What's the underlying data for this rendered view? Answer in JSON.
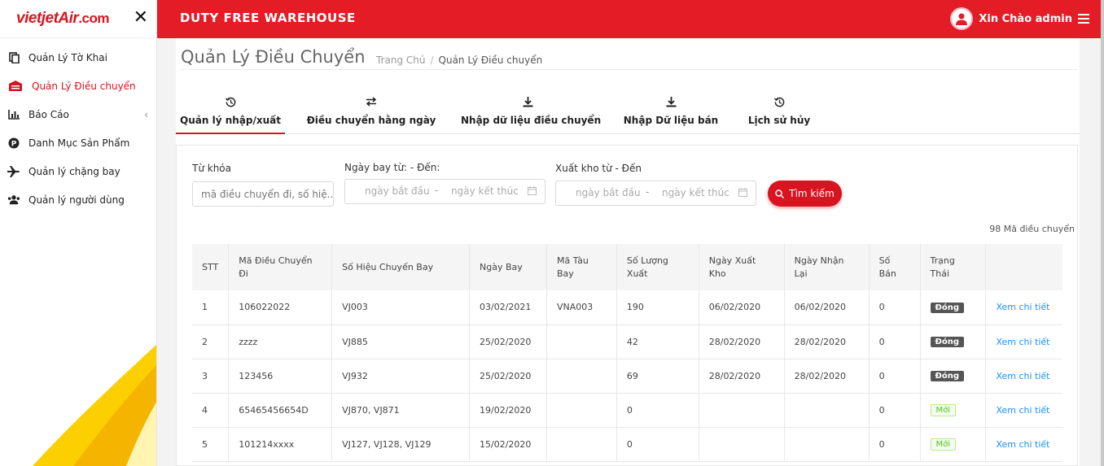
{
  "brand": {
    "logo_main": "vietjet",
    "logo_air": "Air",
    "logo_domain": ".com"
  },
  "sidebar": {
    "items": [
      {
        "label": "Quản Lý Tờ Khai",
        "icon": "copy-icon",
        "active": false
      },
      {
        "label": "Quản Lý Điều chuyển",
        "icon": "warehouse-icon",
        "active": true
      },
      {
        "label": "Báo Cáo",
        "icon": "bar-chart-icon",
        "active": false,
        "chevron": "‹"
      },
      {
        "label": "Danh Mục Sản Phẩm",
        "icon": "product-circle-icon",
        "active": false
      },
      {
        "label": "Quản lý chặng bay",
        "icon": "plane-icon",
        "active": false
      },
      {
        "label": "Quản lý người dùng",
        "icon": "users-icon",
        "active": false
      }
    ]
  },
  "header": {
    "title": "DUTY FREE WAREHOUSE",
    "greeting": "Xin Chào admin"
  },
  "page": {
    "title": "Quản Lý Điều Chuyển",
    "breadcrumb_home": "Trang Chủ",
    "breadcrumb_sep": "/",
    "breadcrumb_current": "Quản Lý Điều chuyển"
  },
  "tabs": [
    {
      "label": "Quản lý nhập/xuất",
      "icon": "history-icon"
    },
    {
      "label": "Điều chuyển hằng ngày",
      "icon": "swap-icon"
    },
    {
      "label": "Nhập dữ liệu điều chuyển",
      "icon": "download-icon"
    },
    {
      "label": "Nhập Dữ liệu bán",
      "icon": "download-icon"
    },
    {
      "label": "Lịch sử hủy",
      "icon": "history-icon"
    }
  ],
  "filters": {
    "keyword_label": "Từ khóa",
    "keyword_placeholder": "mã điều chuyển đi, số hiệ...",
    "flight_date_label": "Ngày bay từ: - Đến:",
    "export_date_label": "Xuất kho từ - Đến",
    "start_placeholder": "ngày bắt đầu",
    "end_placeholder": "ngày kết thúc",
    "range_dash": "-",
    "search_button": "Tìm kiếm"
  },
  "count_text": "98 Mã điều chuyển",
  "table": {
    "headers": [
      "STT",
      "Mã Điều Chuyển Đi",
      "Số Hiệu Chuyến Bay",
      "Ngày Bay",
      "Mã Tàu Bay",
      "Số Lượng Xuất",
      "Ngày Xuất Kho",
      "Ngày Nhận Lại",
      "Số Bán",
      "Trạng Thái",
      ""
    ],
    "rows": [
      {
        "stt": "1",
        "code": "106022022",
        "flight": "VJ003",
        "date": "03/02/2021",
        "aircraft": "VNA003",
        "qty": "190",
        "export": "06/02/2020",
        "received": "06/02/2020",
        "sold": "0",
        "status": "Đóng",
        "action": "Xem chi tiết"
      },
      {
        "stt": "2",
        "code": "zzzz",
        "flight": "VJ885",
        "date": "25/02/2020",
        "aircraft": "",
        "qty": "42",
        "export": "28/02/2020",
        "received": "28/02/2020",
        "sold": "0",
        "status": "Đóng",
        "action": "Xem chi tiết"
      },
      {
        "stt": "3",
        "code": "123456",
        "flight": "VJ932",
        "date": "25/02/2020",
        "aircraft": "",
        "qty": "69",
        "export": "28/02/2020",
        "received": "28/02/2020",
        "sold": "0",
        "status": "Đóng",
        "action": "Xem chi tiết"
      },
      {
        "stt": "4",
        "code": "65465456654D",
        "flight": "VJ870, VJ871",
        "date": "19/02/2020",
        "aircraft": "",
        "qty": "0",
        "export": "",
        "received": "",
        "sold": "0",
        "status": "Mới",
        "action": "Xem chi tiết"
      },
      {
        "stt": "5",
        "code": "101214xxxx",
        "flight": "VJ127, VJ128, VJ129",
        "date": "15/02/2020",
        "aircraft": "",
        "qty": "0",
        "export": "",
        "received": "",
        "sold": "0",
        "status": "Mới",
        "action": "Xem chi tiết"
      }
    ]
  },
  "colors": {
    "primary": "#e31c25",
    "active": "#d7141f",
    "link": "#1890ff",
    "badge_closed": "#555555",
    "badge_new": "#52c41a"
  }
}
